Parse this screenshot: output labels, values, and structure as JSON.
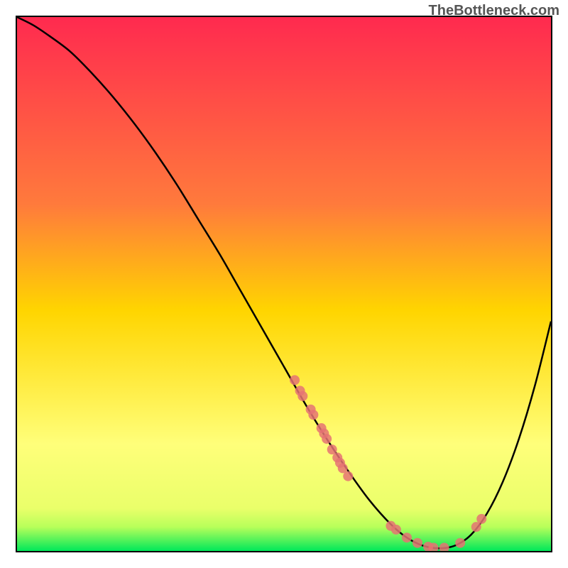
{
  "watermark": "TheBottleneck.com",
  "colors": {
    "gradient_top": "#ff2a4f",
    "gradient_mid": "#ffd500",
    "gradient_low": "#ffff7a",
    "gradient_bottom": "#00e85a",
    "curve": "#000000",
    "points": "#e57373",
    "border": "#000000"
  },
  "chart_data": {
    "type": "line",
    "title": "",
    "xlabel": "",
    "ylabel": "",
    "xlim": [
      0,
      100
    ],
    "ylim": [
      0,
      100
    ],
    "series": [
      {
        "name": "curve",
        "x": [
          0,
          3,
          6,
          10,
          14,
          18,
          22,
          26,
          30,
          34,
          38,
          42,
          46,
          50,
          54,
          58,
          62,
          66,
          70,
          73,
          76,
          79,
          82,
          85,
          88,
          91,
          94,
          97,
          100
        ],
        "y": [
          100,
          98.5,
          96.5,
          93.5,
          89.5,
          85,
          80,
          74.5,
          68.5,
          62,
          55.5,
          48.5,
          41.5,
          34.5,
          27.5,
          21,
          15,
          9.5,
          5,
          2.5,
          1,
          0.5,
          1,
          3,
          7,
          13,
          21,
          31,
          43
        ]
      }
    ],
    "points": [
      {
        "x": 52,
        "y": 32
      },
      {
        "x": 53,
        "y": 30
      },
      {
        "x": 53.5,
        "y": 29
      },
      {
        "x": 55,
        "y": 26.5
      },
      {
        "x": 55.5,
        "y": 25.5
      },
      {
        "x": 57,
        "y": 23
      },
      {
        "x": 57.5,
        "y": 22
      },
      {
        "x": 58,
        "y": 21
      },
      {
        "x": 59,
        "y": 19
      },
      {
        "x": 60,
        "y": 17.5
      },
      {
        "x": 60.5,
        "y": 16.5
      },
      {
        "x": 61,
        "y": 15.5
      },
      {
        "x": 62,
        "y": 14
      },
      {
        "x": 70,
        "y": 4.7
      },
      {
        "x": 71,
        "y": 4
      },
      {
        "x": 73,
        "y": 2.5
      },
      {
        "x": 75,
        "y": 1.5
      },
      {
        "x": 77,
        "y": 0.8
      },
      {
        "x": 78,
        "y": 0.6
      },
      {
        "x": 80,
        "y": 0.6
      },
      {
        "x": 83,
        "y": 1.5
      },
      {
        "x": 86,
        "y": 4.5
      },
      {
        "x": 87,
        "y": 6
      }
    ]
  }
}
